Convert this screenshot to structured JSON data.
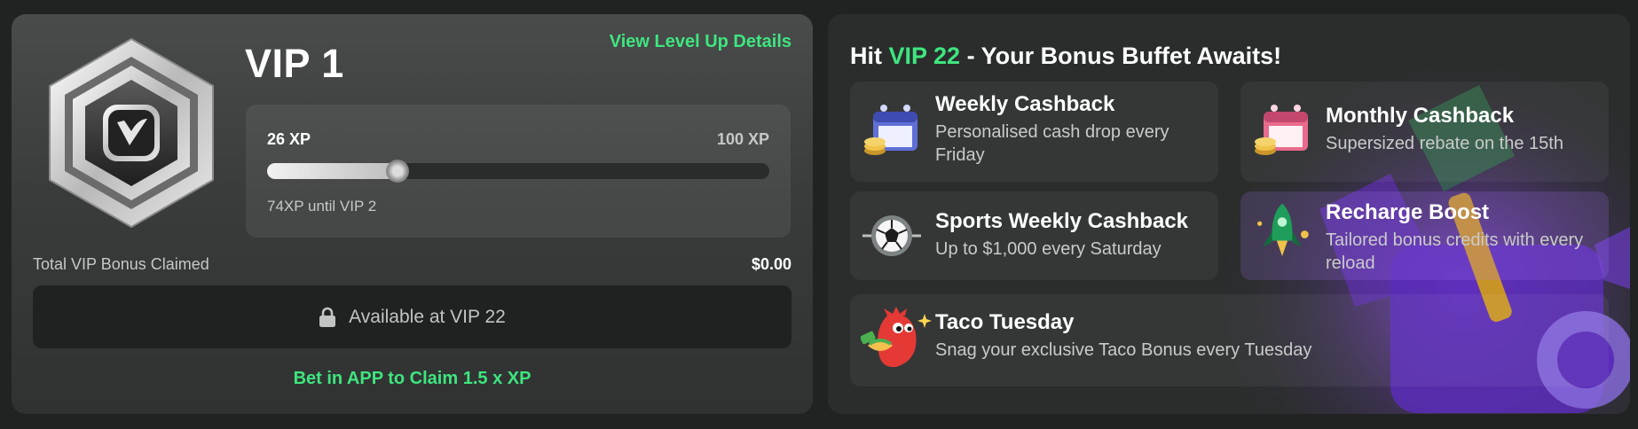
{
  "vip": {
    "level": "VIP 1",
    "level_up_link": "View Level Up Details",
    "xp_current": "26 XP",
    "xp_max": "100 XP",
    "xp_progress_percent": 26,
    "xp_remaining": "74XP until VIP 2",
    "bonus_label": "Total VIP Bonus Claimed",
    "bonus_value": "$0.00",
    "claim_button": "Available at VIP 22",
    "bet_app_text": "Bet in APP to Claim 1.5 x XP",
    "badge_icon": "vip-silver-hexagon-icon"
  },
  "perks": {
    "heading_prefix": "Hit ",
    "heading_highlight": "VIP 22",
    "heading_suffix": " - Your Bonus Buffet Awaits!",
    "items": [
      {
        "title": "Weekly Cashback",
        "desc": "Personalised cash drop every Friday",
        "icon": "calendar-coins-icon"
      },
      {
        "title": "Monthly Cashback",
        "desc": "Supersized rebate on the 15th",
        "icon": "calendar-coins-icon"
      },
      {
        "title": "Sports Weekly Cashback",
        "desc": "Up to $1,000 every Saturday",
        "icon": "soccer-ball-icon"
      },
      {
        "title": "Recharge Boost",
        "desc": "Tailored bonus credits with every reload",
        "icon": "rocket-icon"
      },
      {
        "title": "Taco Tuesday",
        "desc": "Snag your exclusive Taco Bonus every Tuesday",
        "icon": "taco-dragon-icon"
      }
    ]
  },
  "colors": {
    "accent": "#3ee67f",
    "background": "#202322",
    "card": "#2b2d2d"
  }
}
